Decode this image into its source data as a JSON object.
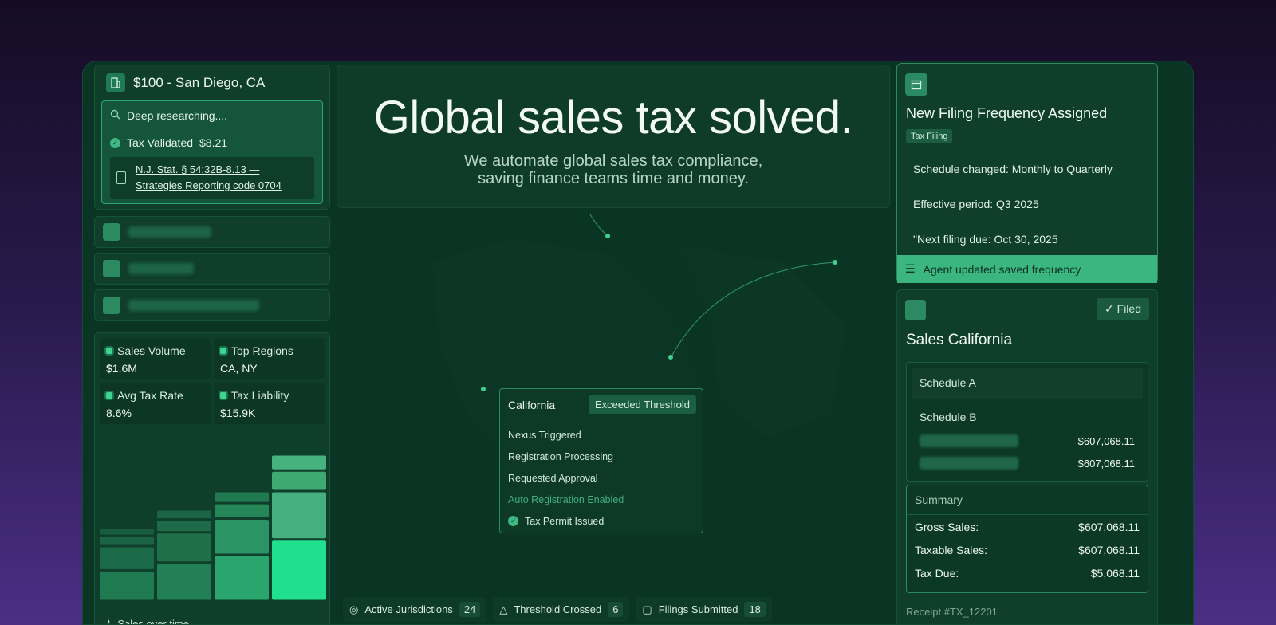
{
  "location": {
    "title": "$100 - San Diego, CA"
  },
  "research": {
    "status": "Deep researching....",
    "validated_label": "Tax Validated",
    "validated_value": "$8.21",
    "citation_line1": "N.J. Stat. § 54:32B-8.13 —",
    "citation_line2": "Strategies Reporting code 0704"
  },
  "stats": [
    {
      "label": "Sales Volume",
      "value": "$1.6M"
    },
    {
      "label": "Top Regions",
      "value": "CA, NY"
    },
    {
      "label": "Avg Tax Rate",
      "value": "8.6%"
    },
    {
      "label": "Tax Liability",
      "value": "$15.9K"
    }
  ],
  "chart_footer": "Sales over time",
  "hero": {
    "title": "Global sales tax solved.",
    "subtitle_line1": "We automate global sales tax compliance,",
    "subtitle_line2": "saving finance teams time and money."
  },
  "california": {
    "name": "California",
    "badge": "Exceeded Threshold",
    "steps": [
      "Nexus Triggered",
      "Registration Processing",
      "Requested Approval",
      "Auto Registration Enabled",
      "Tax Permit Issued"
    ]
  },
  "bottom_stats": [
    {
      "label": "Active Jurisdictions",
      "value": "24"
    },
    {
      "label": "Threshold Crossed",
      "value": "6"
    },
    {
      "label": "Filings Submitted",
      "value": "18"
    }
  ],
  "filing": {
    "title": "New Filing Frequency Assigned",
    "tag": "Tax Filing",
    "rows": [
      "Schedule changed: Monthly to Quarterly",
      "Effective period: Q3 2025",
      "\"Next filing due: Oct 30, 2025"
    ],
    "agent_note": "Agent updated saved frequency"
  },
  "sales": {
    "filed_label": "Filed",
    "title": "Sales California",
    "schedule_a": "Schedule A",
    "schedule_b": "Schedule B",
    "sched_values": [
      "$607,068.11",
      "$607,068.11"
    ],
    "summary_title": "Summary",
    "summary": [
      {
        "label": "Gross Sales:",
        "value": "$607,068.11"
      },
      {
        "label": "Taxable Sales:",
        "value": "$607,068.11"
      },
      {
        "label": "Tax Due:",
        "value": "$5,068.11"
      }
    ],
    "receipt": "Receipt #TX_12201"
  },
  "chart_data": {
    "type": "bar",
    "categories": [
      "1",
      "2",
      "3",
      "4"
    ],
    "values": [
      4,
      5,
      6,
      8
    ]
  }
}
